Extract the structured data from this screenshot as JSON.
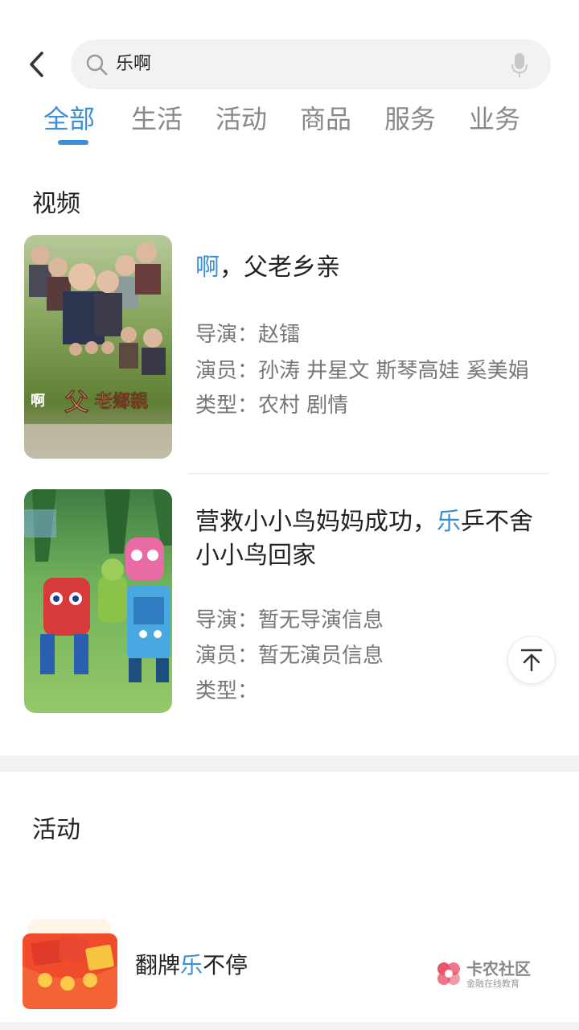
{
  "search": {
    "query": "乐啊"
  },
  "tabs": [
    {
      "label": "全部",
      "active": true
    },
    {
      "label": "生活",
      "active": false
    },
    {
      "label": "活动",
      "active": false
    },
    {
      "label": "商品",
      "active": false
    },
    {
      "label": "服务",
      "active": false
    },
    {
      "label": "业务",
      "active": false
    }
  ],
  "colors": {
    "accent": "#3a8fd8",
    "text": "#222222",
    "secondary": "#777777"
  },
  "sections": {
    "video": {
      "title": "视频",
      "items": [
        {
          "title_highlight": "啊",
          "title_rest": "，父老乡亲",
          "director": "导演：赵镭",
          "actors": "演员：孙涛 井星文 斯琴高娃 奚美娟",
          "genre": "类型：农村 剧情",
          "poster_text": "啊 父老鄉親"
        },
        {
          "title_before": "营救小小鸟妈妈成功，",
          "title_highlight": "乐",
          "title_after": "乒不舍小小鸟回家",
          "director": "导演：暂无导演信息",
          "actors": "演员：暂无演员信息",
          "genre": "类型："
        }
      ]
    },
    "activity": {
      "title": "活动",
      "items": [
        {
          "label_before": "翻牌",
          "label_highlight": "乐",
          "label_after": "不停"
        }
      ]
    }
  },
  "watermark": {
    "title": "卡农社区",
    "subtitle": "金融在线教育"
  },
  "icons": [
    "back-arrow-icon",
    "search-icon",
    "microphone-icon",
    "back-to-top-icon",
    "red-envelope-icon",
    "kanong-logo-icon"
  ]
}
